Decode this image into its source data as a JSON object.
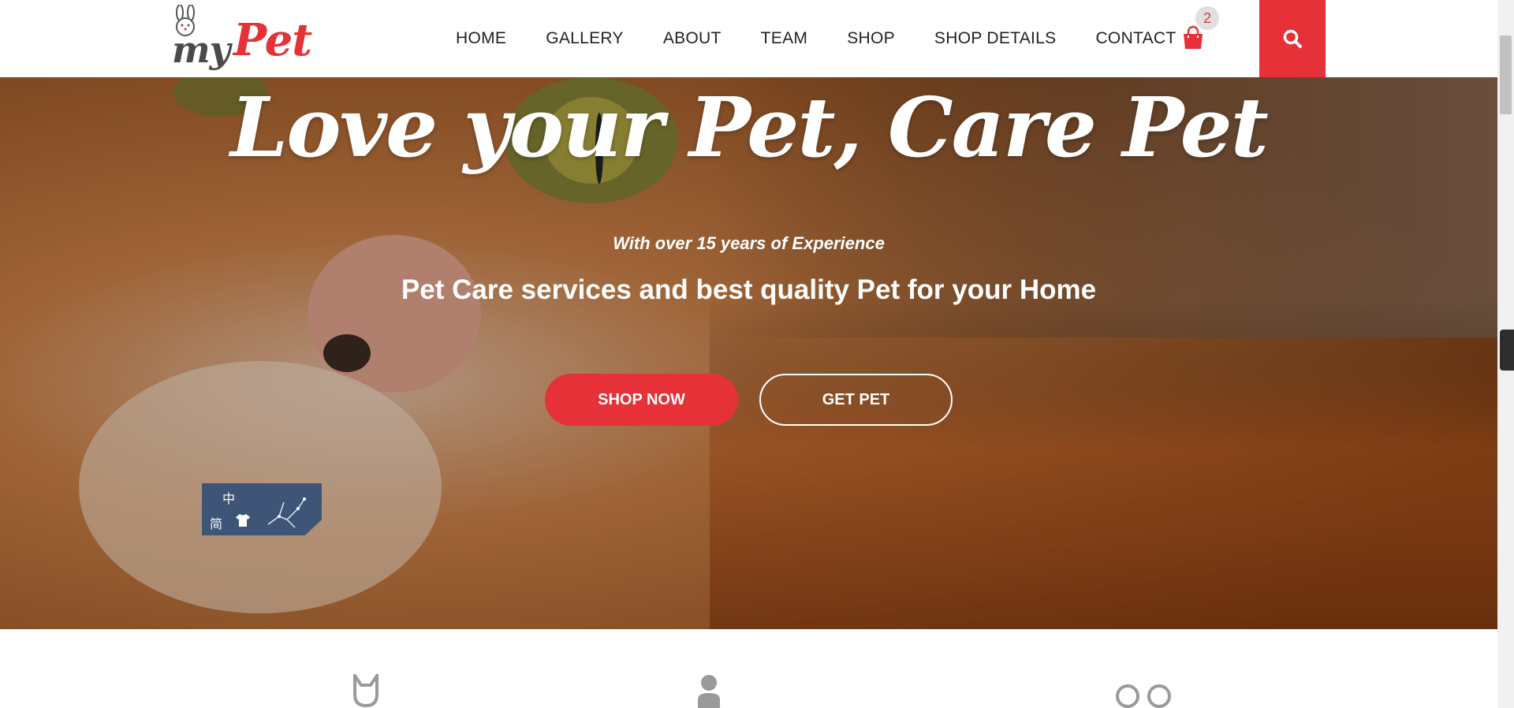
{
  "logo": {
    "my": "my",
    "pet": "Pet"
  },
  "nav": {
    "items": [
      "HOME",
      "GALLERY",
      "ABOUT",
      "TEAM",
      "SHOP",
      "SHOP DETAILS",
      "CONTACT"
    ]
  },
  "cart": {
    "count": "2",
    "icon": "shopping-bag-icon"
  },
  "search": {
    "icon": "search-icon"
  },
  "hero": {
    "title": "Love your Pet, Care Pet",
    "subtitle": "With over 15 years of Experience",
    "tagline": "Pet Care services and best quality Pet for your Home",
    "shop_button": "SHOP NOW",
    "get_button": "GET PET"
  },
  "lang_widget": {
    "char_traditional": "中",
    "char_simplified": "简"
  },
  "features": {
    "icons": [
      "cat-icon",
      "person-icon",
      "rings-icon"
    ]
  },
  "colors": {
    "accent": "#e53137",
    "text": "#222222",
    "widget": "#3e5577"
  }
}
